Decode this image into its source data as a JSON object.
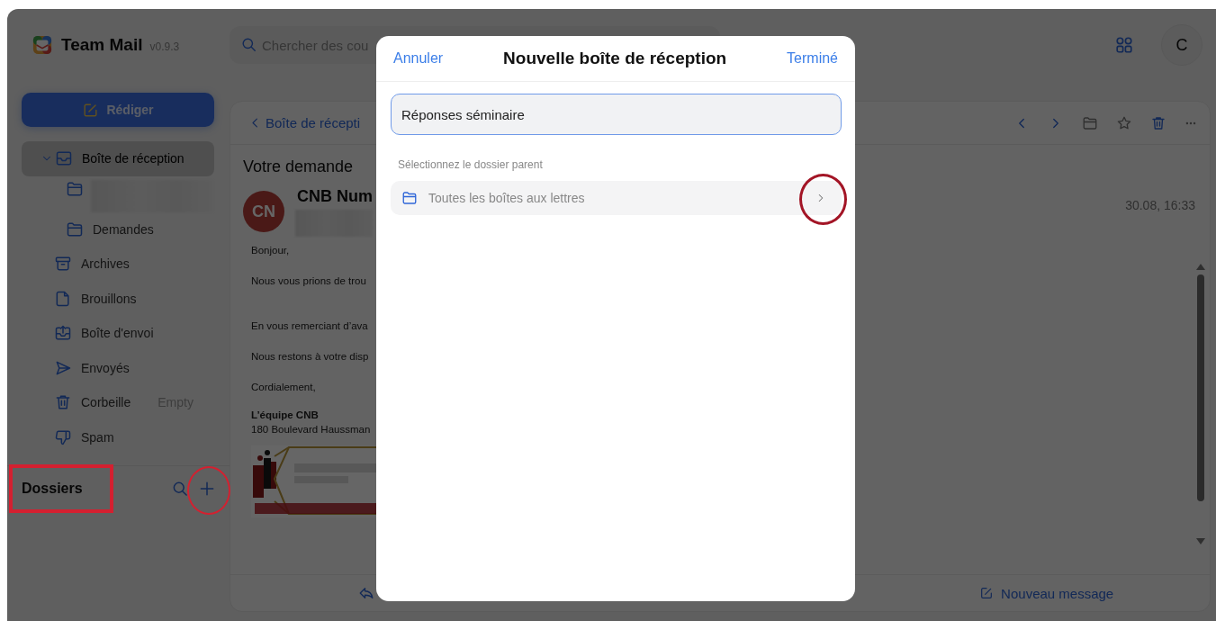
{
  "app": {
    "name": "Team Mail",
    "version": "v0.9.3"
  },
  "search": {
    "placeholder": "Chercher des cou"
  },
  "profile": {
    "initial": "C"
  },
  "compose_button": {
    "label": "Rédiger"
  },
  "sidebar": {
    "items": [
      {
        "kind": "inbox",
        "label": "Boîte de réception",
        "expanded": true,
        "selected": true,
        "children": [
          {
            "kind": "folder",
            "redacted": true,
            "selected": false
          },
          {
            "kind": "folder",
            "label": "Demandes",
            "selected": false
          }
        ]
      },
      {
        "kind": "archive",
        "label": "Archives",
        "selected": false
      },
      {
        "kind": "drafts",
        "label": "Brouillons",
        "selected": false
      },
      {
        "kind": "outbox",
        "label": "Boîte d'envoi",
        "selected": false
      },
      {
        "kind": "sent",
        "label": "Envoyés",
        "selected": false
      },
      {
        "kind": "trash",
        "label": "Corbeille",
        "action": "Empty",
        "selected": false
      },
      {
        "kind": "spam",
        "label": "Spam",
        "selected": false
      }
    ]
  },
  "folders_section": {
    "title": "Dossiers",
    "title_marked": true,
    "add_marked": true
  },
  "message": {
    "back_label": "Boîte de récepti",
    "subject": "Votre demande",
    "sender": {
      "initials": "CN",
      "name": "CNB Num",
      "address_redacted": true
    },
    "date": "30.08, 16:33",
    "body": [
      {
        "kind": "paragraph",
        "text": "Bonjour,"
      },
      {
        "kind": "paragraph",
        "text": "Nous vous prions de trou"
      },
      {
        "kind": "spacer"
      },
      {
        "kind": "paragraph",
        "text": "En vous remerciant d’ava"
      },
      {
        "kind": "paragraph",
        "text": "Nous restons à votre disp"
      },
      {
        "kind": "paragraph",
        "text": "Cordialement,"
      },
      {
        "kind": "signature",
        "name": "L’équipe CNB",
        "address": "180 Boulevard Haussman"
      },
      {
        "kind": "picture"
      }
    ],
    "footer": {
      "new_message": "Nouveau message"
    }
  },
  "dialog": {
    "cancel": "Annuler",
    "title": "Nouvelle boîte de réception",
    "done": "Terminé",
    "name_value": "Réponses séminaire",
    "focused": true,
    "parent_label": "Sélectionnez le dossier parent",
    "parent_option": "Toutes les boîtes aux lettres",
    "chevron_marked": true
  }
}
